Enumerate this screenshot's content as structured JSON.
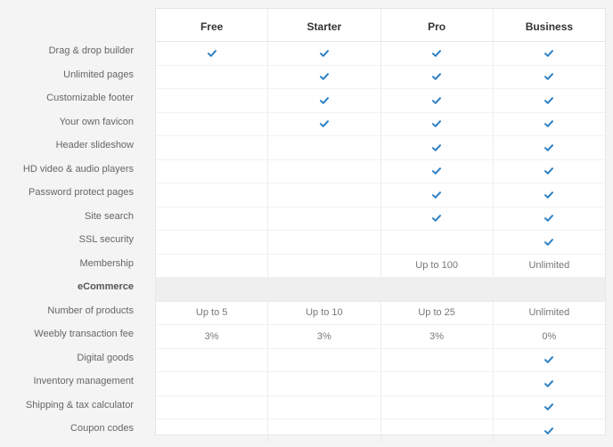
{
  "plans": [
    "Free",
    "Starter",
    "Pro",
    "Business"
  ],
  "features": [
    {
      "label": "Drag & drop builder",
      "values": [
        "check",
        "check",
        "check",
        "check"
      ]
    },
    {
      "label": "Unlimited pages",
      "values": [
        "",
        "check",
        "check",
        "check"
      ]
    },
    {
      "label": "Customizable footer",
      "values": [
        "",
        "check",
        "check",
        "check"
      ]
    },
    {
      "label": "Your own favicon",
      "values": [
        "",
        "check",
        "check",
        "check"
      ]
    },
    {
      "label": "Header slideshow",
      "values": [
        "",
        "",
        "check",
        "check"
      ]
    },
    {
      "label": "HD video & audio players",
      "values": [
        "",
        "",
        "check",
        "check"
      ]
    },
    {
      "label": "Password protect pages",
      "values": [
        "",
        "",
        "check",
        "check"
      ]
    },
    {
      "label": "Site search",
      "values": [
        "",
        "",
        "check",
        "check"
      ]
    },
    {
      "label": "SSL security",
      "values": [
        "",
        "",
        "",
        "check"
      ]
    },
    {
      "label": "Membership",
      "values": [
        "",
        "",
        "Up to 100",
        "Unlimited"
      ]
    },
    {
      "label": "eCommerce",
      "section": true,
      "values": [
        "",
        "",
        "",
        ""
      ]
    },
    {
      "label": "Number of products",
      "values": [
        "Up to 5",
        "Up to 10",
        "Up to 25",
        "Unlimited"
      ]
    },
    {
      "label": "Weebly transaction fee",
      "values": [
        "3%",
        "3%",
        "3%",
        "0%"
      ]
    },
    {
      "label": "Digital goods",
      "values": [
        "",
        "",
        "",
        "check"
      ]
    },
    {
      "label": "Inventory management",
      "values": [
        "",
        "",
        "",
        "check"
      ]
    },
    {
      "label": "Shipping & tax calculator",
      "values": [
        "",
        "",
        "",
        "check"
      ]
    },
    {
      "label": "Coupon codes",
      "values": [
        "",
        "",
        "",
        "check"
      ]
    }
  ],
  "colors": {
    "check": "#2b7fc3",
    "section_bg": "#efefef"
  }
}
